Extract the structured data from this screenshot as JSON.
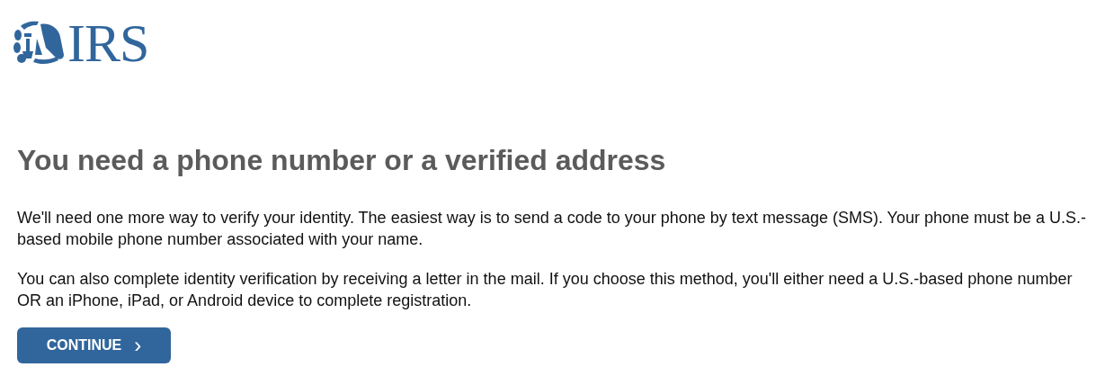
{
  "logo": {
    "text": "IRS"
  },
  "heading": "You need a phone number or a verified address",
  "paragraphs": [
    "We'll need one more way to verify your identity. The easiest way is to send a code to your phone by text message (SMS). Your phone must be a U.S.-based mobile phone number associated with your name.",
    "You can also complete identity verification by receiving a letter in the mail. If you choose this method, you'll either need a U.S.-based phone number OR an iPhone, iPad, or Android device to complete registration."
  ],
  "button": {
    "label": "CONTINUE",
    "icon": "›"
  }
}
